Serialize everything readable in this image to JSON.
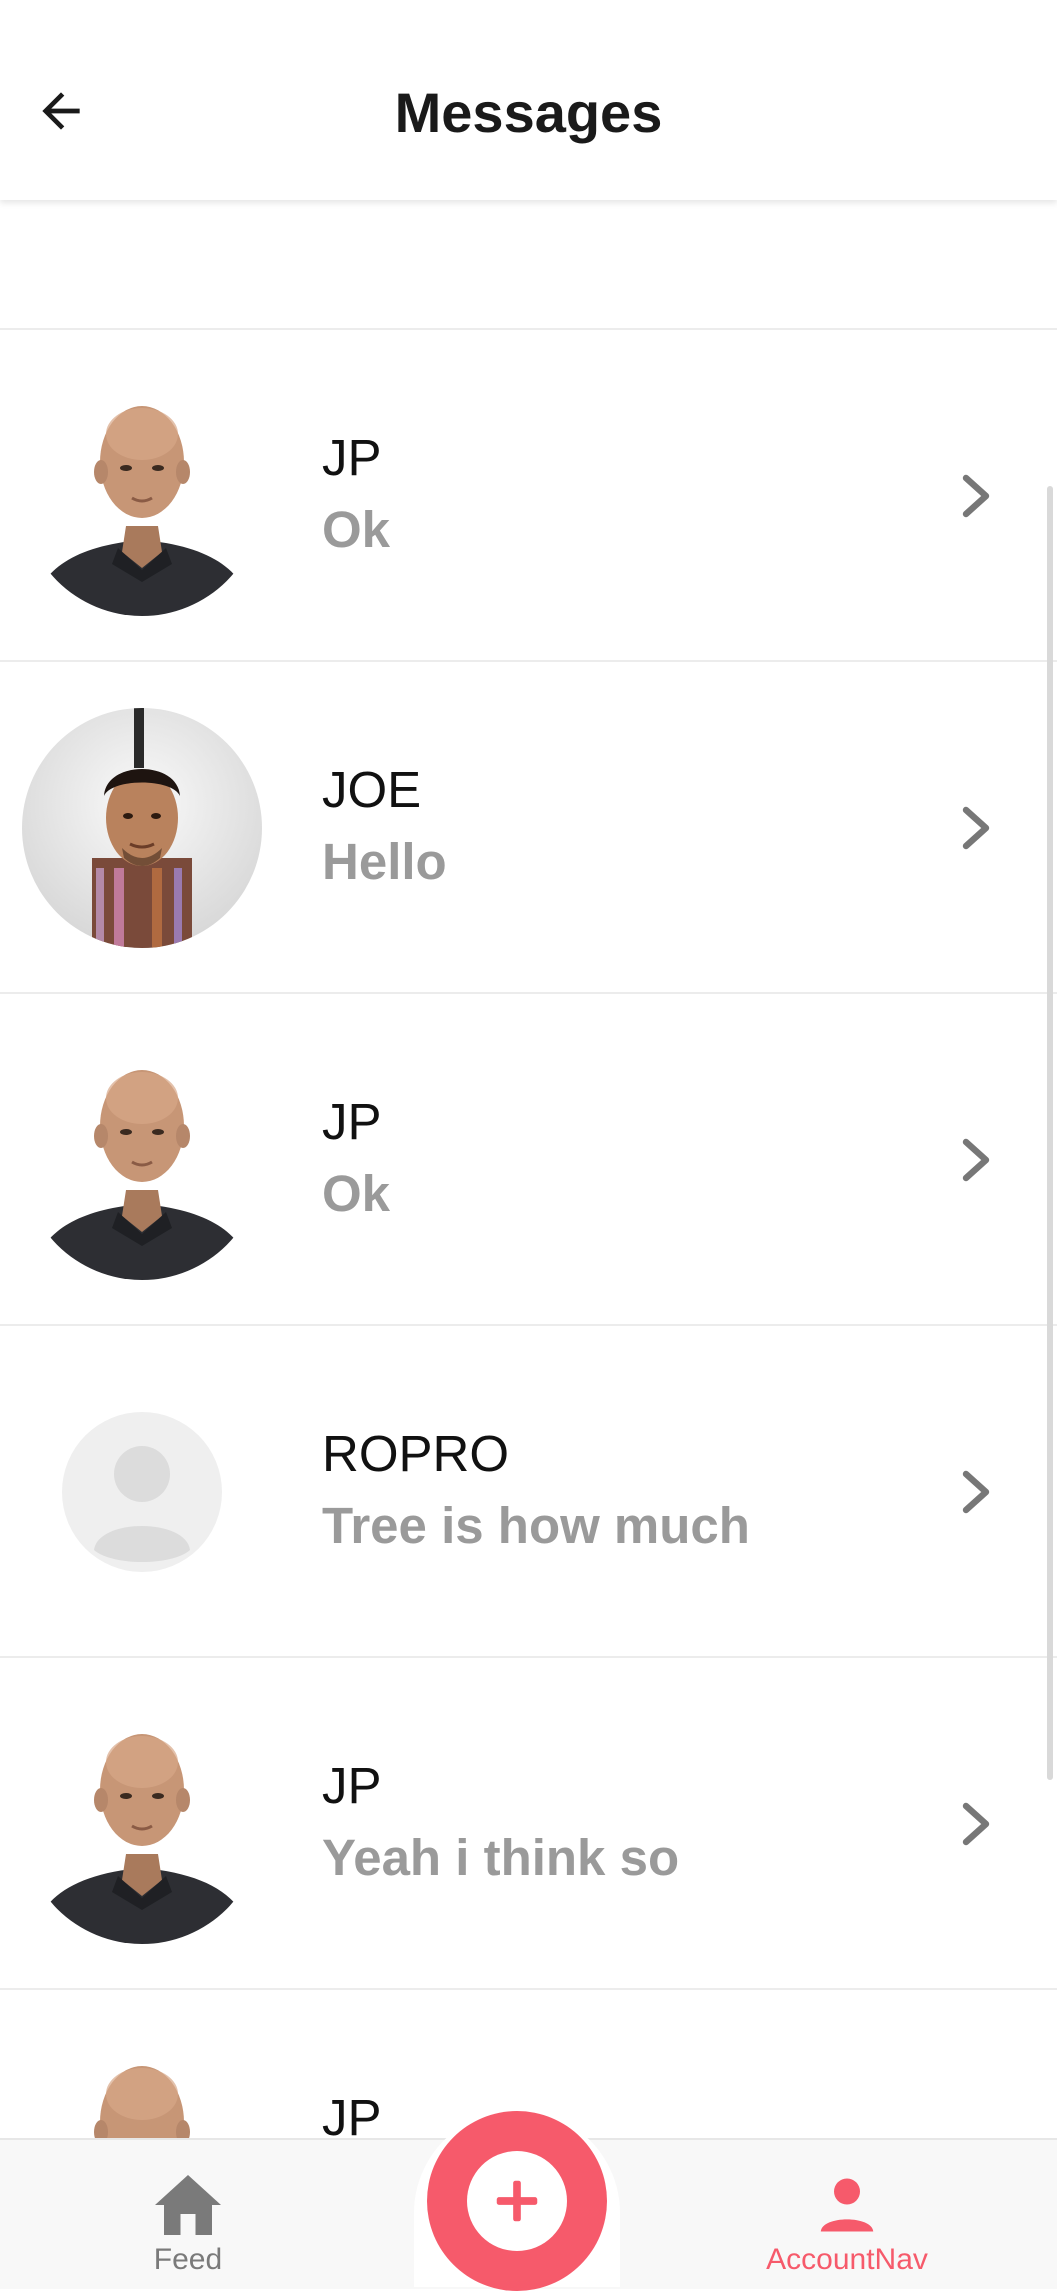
{
  "header": {
    "title": "Messages",
    "back_icon": "arrow-left-icon"
  },
  "conversations": [
    {
      "name": "JP",
      "message": "Ok",
      "avatar": "photo-bald-man"
    },
    {
      "name": "JOE",
      "message": "Hello",
      "avatar": "photo-curly-hair-man"
    },
    {
      "name": "JP",
      "message": "Ok",
      "avatar": "photo-bald-man"
    },
    {
      "name": "ROPRO",
      "message": "Tree is how much",
      "avatar": "default-user-placeholder"
    },
    {
      "name": "JP",
      "message": "Yeah i think so",
      "avatar": "photo-bald-man"
    },
    {
      "name": "JP",
      "message": "",
      "avatar": "photo-bald-man"
    }
  ],
  "bottom_nav": {
    "feed_label": "Feed",
    "feed_icon": "home-icon",
    "add_icon": "plus-circle-icon",
    "account_label": "AccountNav",
    "account_icon": "person-icon",
    "active_tab": "AccountNav"
  },
  "colors": {
    "accent": "#f65a6b",
    "secondary_text": "#9a9a9a",
    "inactive_nav": "#7a7a7a"
  }
}
